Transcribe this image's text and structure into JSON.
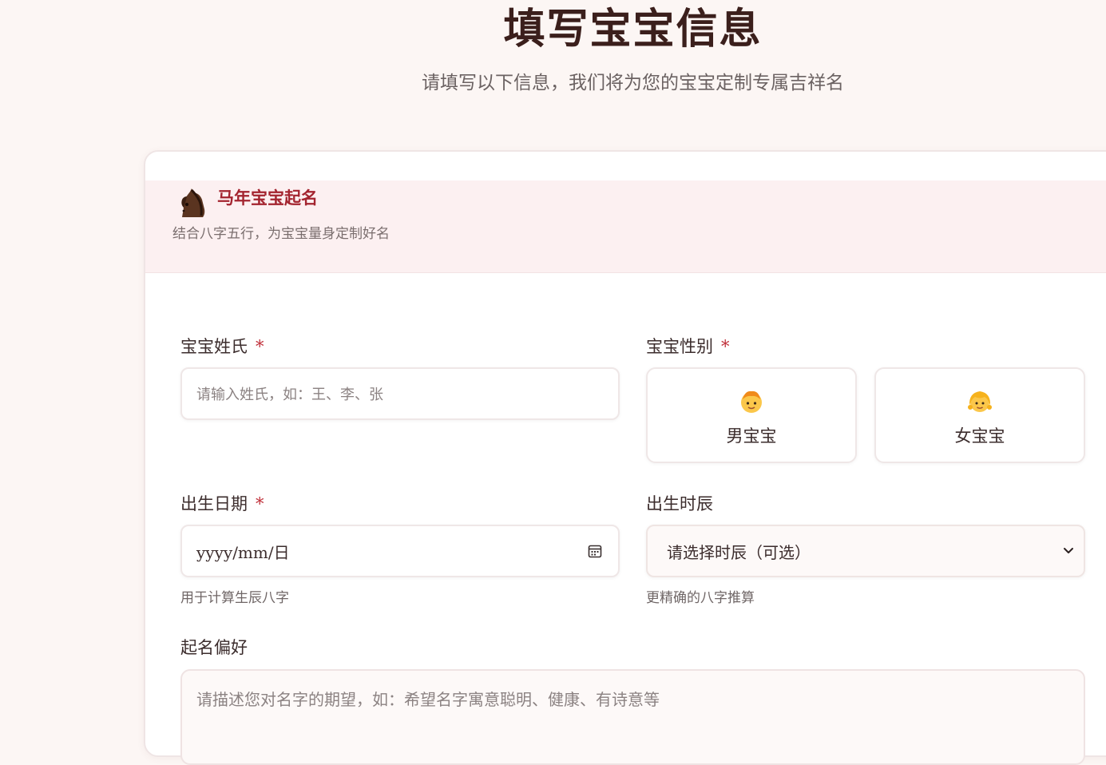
{
  "page": {
    "title": "填写宝宝信息",
    "subtitle": "请填写以下信息，我们将为您的宝宝定制专属吉祥名"
  },
  "card": {
    "icon": "horse-icon",
    "title": "马年宝宝起名",
    "description": "结合八字五行，为宝宝量身定制好名"
  },
  "form": {
    "surname": {
      "label": "宝宝姓氏",
      "required_mark": "*",
      "placeholder": "请输入姓氏，如：王、李、张"
    },
    "gender": {
      "label": "宝宝性别",
      "required_mark": "*",
      "options": [
        {
          "label": "男宝宝",
          "icon": "boy-face-icon"
        },
        {
          "label": "女宝宝",
          "icon": "girl-face-icon"
        }
      ]
    },
    "birth_date": {
      "label": "出生日期",
      "required_mark": "*",
      "placeholder": "yyyy/mm/日",
      "hint": "用于计算生辰八字"
    },
    "birth_hour": {
      "label": "出生时辰",
      "selected": "请选择时辰（可选）",
      "hint": "更精确的八字推算"
    },
    "preference": {
      "label": "起名偏好",
      "placeholder": "请描述您对名字的期望，如：希望名字寓意聪明、健康、有诗意等"
    }
  },
  "colors": {
    "background": "#fcf6f4",
    "accent": "#a3242f",
    "required": "#c0303a",
    "header_band": "#fcf0f1"
  }
}
